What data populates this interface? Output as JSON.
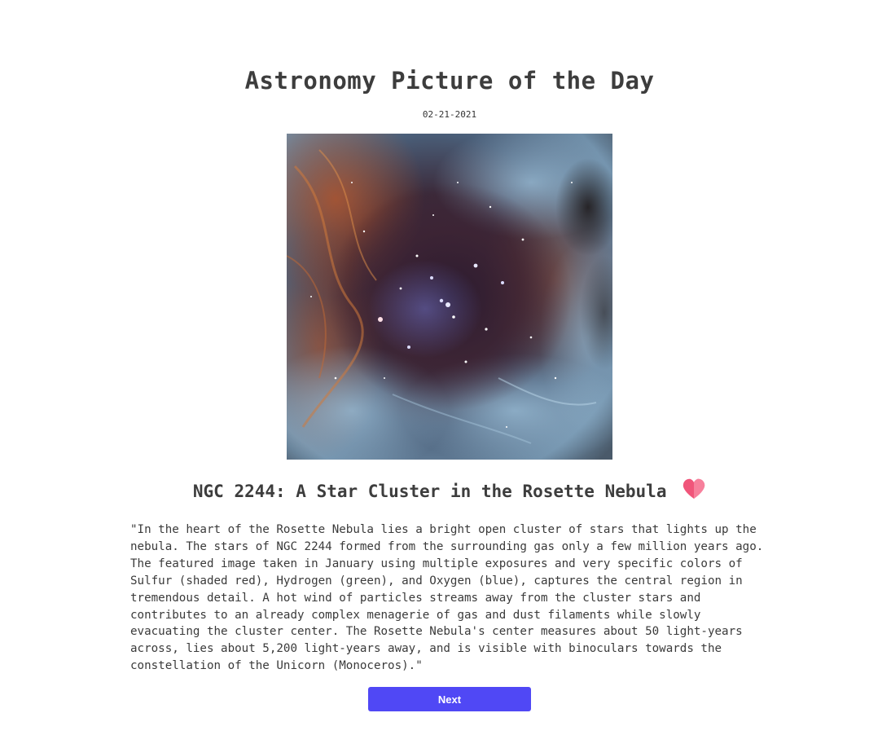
{
  "header": {
    "title": "Astronomy Picture of the Day",
    "date": "02-21-2021"
  },
  "picture": {
    "title": "NGC 2244: A Star Cluster in the Rosette Nebula",
    "explanation": "\"In the heart of the Rosette Nebula lies a bright open cluster of stars that lights up the nebula. The stars of NGC 2244 formed from the surrounding gas only a few million years ago. The featured image taken in January using multiple exposures and very specific colors of Sulfur (shaded red), Hydrogen (green), and Oxygen (blue), captures the central region in tremendous detail. A hot wind of particles streams away from the cluster stars and contributes to an already complex menagerie of gas and dust filaments while slowly evacuating the cluster center. The Rosette Nebula's center measures about 50 light-years across, lies about 5,200 light-years away, and is visible with binoculars towards the constellation of the Unicorn (Monoceros).\"",
    "favorite_icon": "heart-icon"
  },
  "actions": {
    "next_label": "Next"
  },
  "colors": {
    "button": "#5048f5",
    "heart": "#f0557a",
    "text": "#3a3a3a"
  }
}
